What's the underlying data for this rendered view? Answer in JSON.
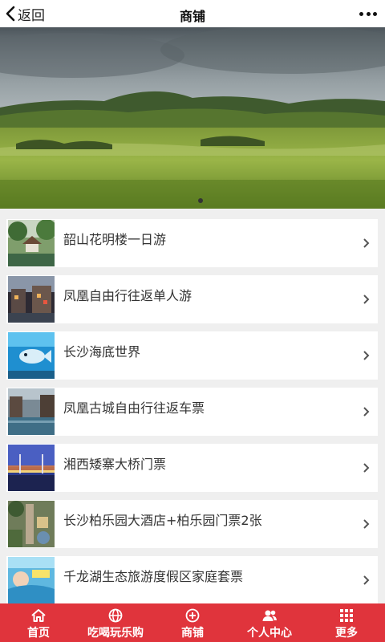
{
  "header": {
    "back_label": "返回",
    "title": "商铺"
  },
  "banner": {
    "active_slide": 1,
    "slide_count": 1
  },
  "items": [
    {
      "title": "韶山花明楼一日游",
      "thumb": "garden-pavilion"
    },
    {
      "title": "凤凰自由行往返单人游",
      "thumb": "old-town-night"
    },
    {
      "title": "长沙海底世界",
      "thumb": "aquarium"
    },
    {
      "title": "凤凰古城自由行往返车票",
      "thumb": "river-town"
    },
    {
      "title": "湘西矮寨大桥门票",
      "thumb": "bridge-sunset"
    },
    {
      "title": "长沙柏乐园大酒店+柏乐园门票2张",
      "thumb": "park-aerial"
    },
    {
      "title": "千龙湖生态旅游度假区家庭套票",
      "thumb": "water-park"
    }
  ],
  "tabs": [
    {
      "label": "首页",
      "icon": "home-icon"
    },
    {
      "label": "吃喝玩乐购",
      "icon": "globe-icon"
    },
    {
      "label": "商铺",
      "icon": "plus-circle-icon"
    },
    {
      "label": "个人中心",
      "icon": "users-icon"
    },
    {
      "label": "更多",
      "icon": "grid-icon"
    }
  ],
  "colors": {
    "tabbar": "#e0343c",
    "background": "#efefef"
  }
}
